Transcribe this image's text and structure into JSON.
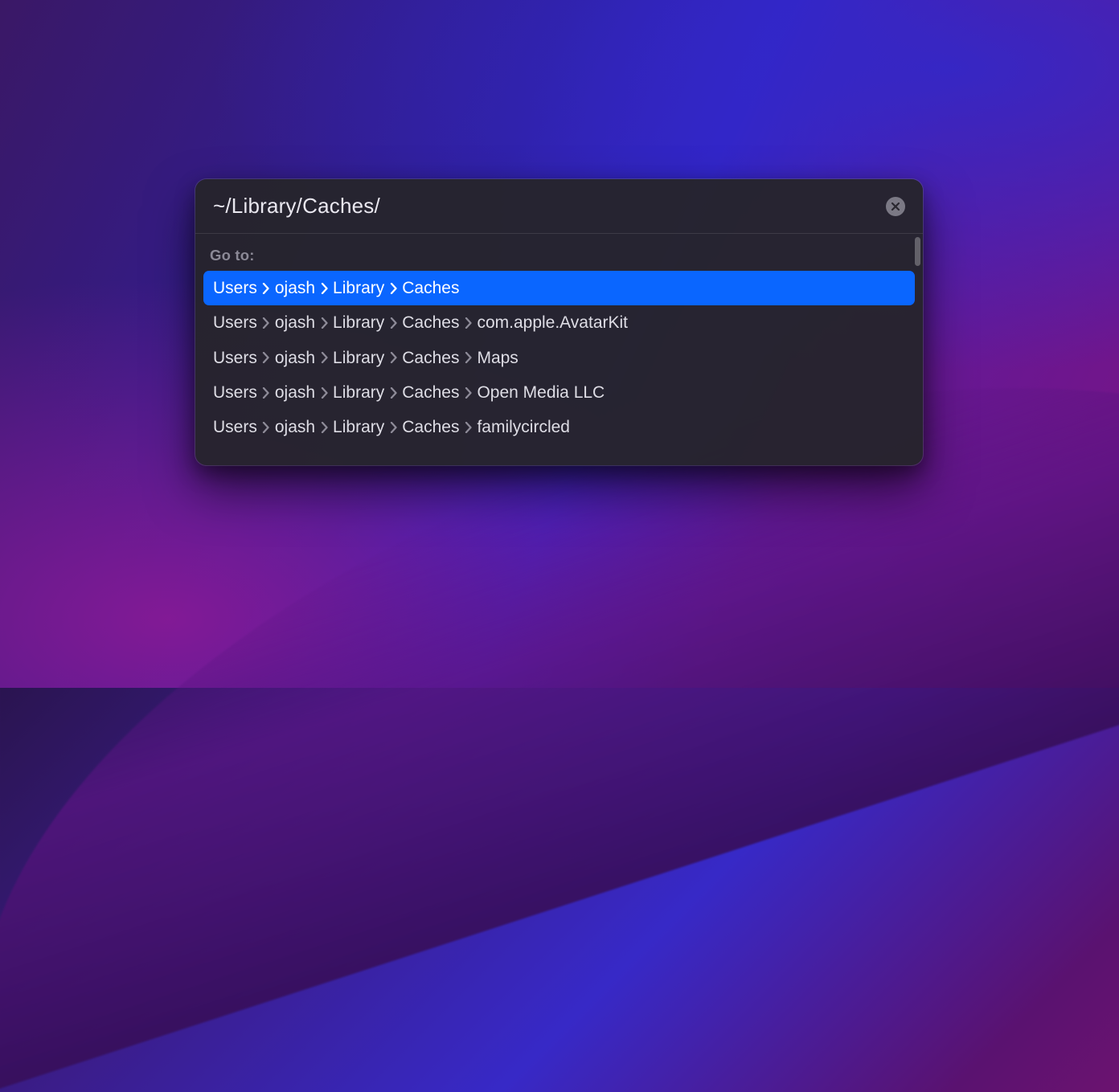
{
  "search": {
    "value": "~/Library/Caches/"
  },
  "section_label": "Go to:",
  "results": [
    {
      "segments": [
        "Users",
        "ojash",
        "Library",
        "Caches"
      ],
      "selected": true
    },
    {
      "segments": [
        "Users",
        "ojash",
        "Library",
        "Caches",
        "com.apple.AvatarKit"
      ],
      "selected": false
    },
    {
      "segments": [
        "Users",
        "ojash",
        "Library",
        "Caches",
        "Maps"
      ],
      "selected": false
    },
    {
      "segments": [
        "Users",
        "ojash",
        "Library",
        "Caches",
        "Open Media LLC"
      ],
      "selected": false
    },
    {
      "segments": [
        "Users",
        "ojash",
        "Library",
        "Caches",
        "familycircled"
      ],
      "selected": false
    }
  ],
  "colors": {
    "selection": "#0a66ff"
  }
}
